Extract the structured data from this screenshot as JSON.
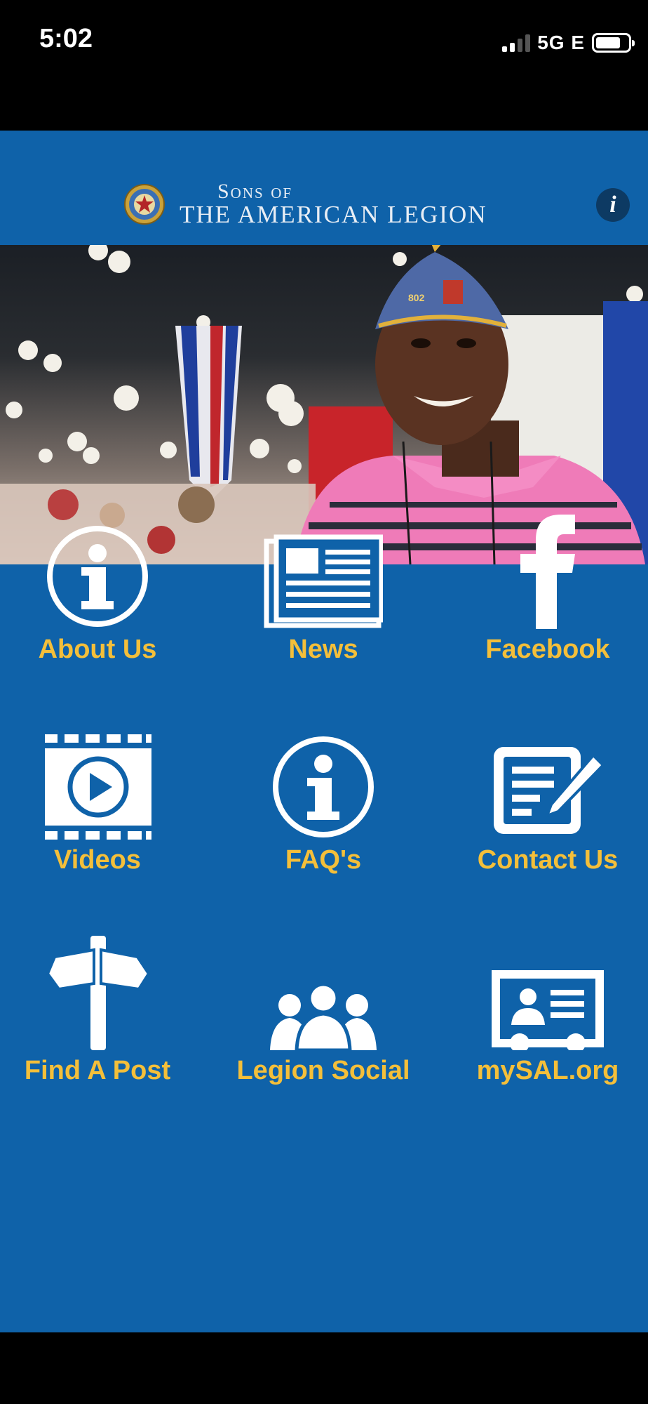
{
  "status": {
    "time": "5:02",
    "network": "5G E"
  },
  "header": {
    "brand_line1": "Sons of",
    "brand_line2": "The American Legion",
    "info_icon": "info-icon"
  },
  "hero": {
    "image": "member-photo"
  },
  "menu": [
    {
      "label": "About Us",
      "icon": "info-circle-icon"
    },
    {
      "label": "News",
      "icon": "newspaper-icon"
    },
    {
      "label": "Facebook",
      "icon": "facebook-icon"
    },
    {
      "label": "Videos",
      "icon": "video-play-icon"
    },
    {
      "label": "FAQ's",
      "icon": "info-circle-icon"
    },
    {
      "label": "Contact Us",
      "icon": "edit-form-icon"
    },
    {
      "label": "Find A Post",
      "icon": "signpost-icon"
    },
    {
      "label": "Legion Social",
      "icon": "people-group-icon"
    },
    {
      "label": "mySAL.org",
      "icon": "id-card-icon"
    }
  ],
  "colors": {
    "background": "#0f62a9",
    "accent": "#f4bf3a",
    "icon": "#ffffff"
  }
}
